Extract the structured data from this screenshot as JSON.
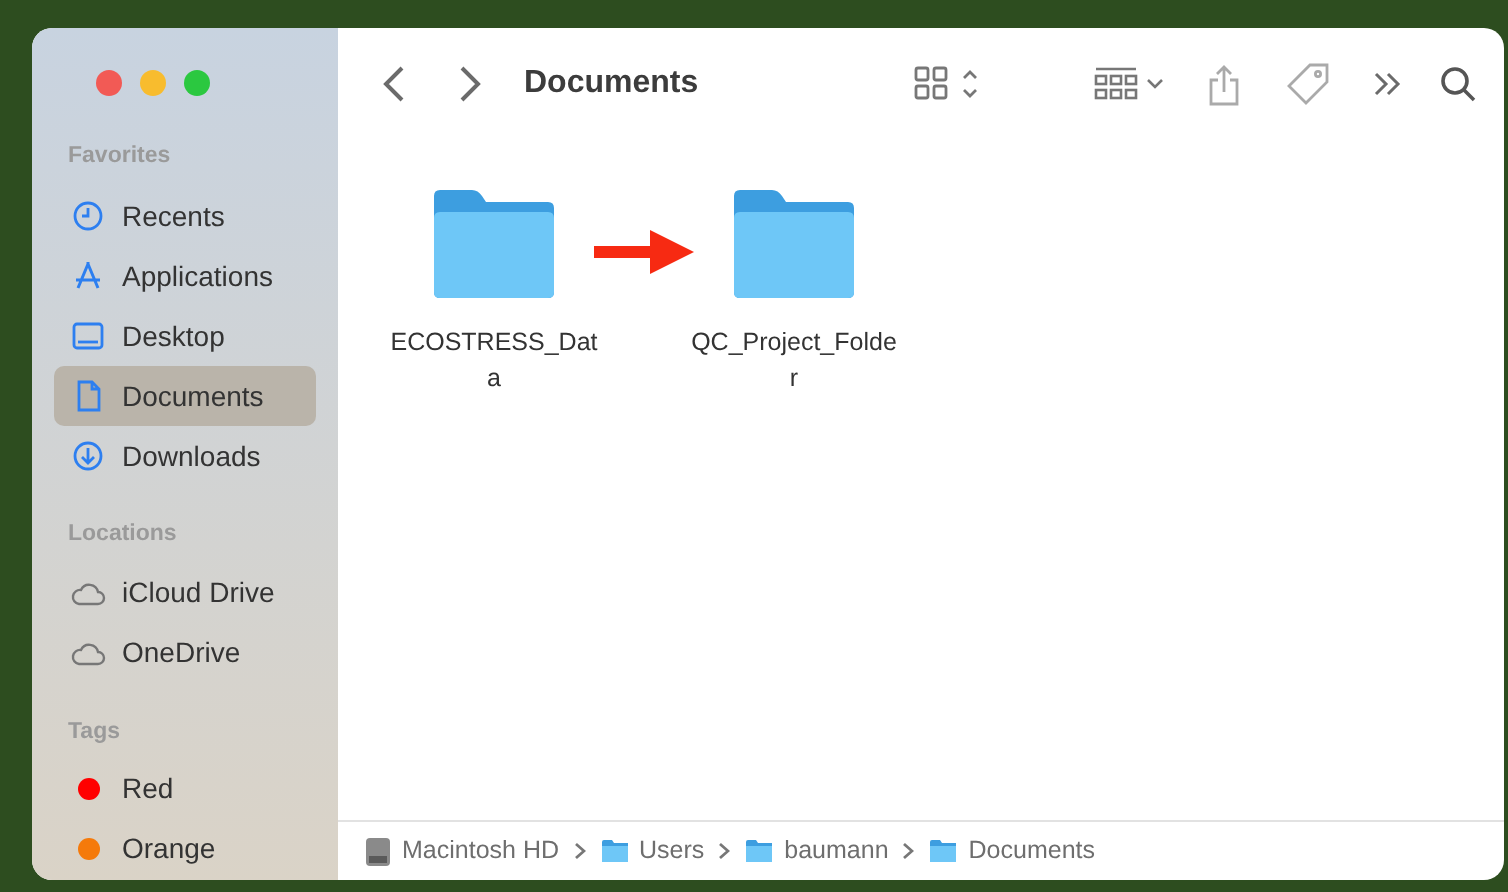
{
  "window": {
    "title": "Documents"
  },
  "sidebar": {
    "sections": [
      {
        "header": "Favorites",
        "items": [
          {
            "label": "Recents",
            "kind": "clock",
            "selected": false
          },
          {
            "label": "Applications",
            "kind": "apps",
            "selected": false
          },
          {
            "label": "Desktop",
            "kind": "desktop",
            "selected": false
          },
          {
            "label": "Documents",
            "kind": "doc",
            "selected": true
          },
          {
            "label": "Downloads",
            "kind": "download",
            "selected": false
          }
        ]
      },
      {
        "header": "Locations",
        "items": [
          {
            "label": "iCloud Drive",
            "kind": "cloud",
            "selected": false
          },
          {
            "label": "OneDrive",
            "kind": "cloud",
            "selected": false
          }
        ]
      },
      {
        "header": "Tags",
        "items": [
          {
            "label": "Red",
            "kind": "tag",
            "color": "#ff0000",
            "selected": false
          },
          {
            "label": "Orange",
            "kind": "tag",
            "color": "#f57a0b",
            "selected": false
          }
        ]
      }
    ]
  },
  "files": [
    {
      "name": "ECOSTRESS_Dat\na"
    },
    {
      "name": "QC_Project_Folde\nr"
    }
  ],
  "path_bar": [
    {
      "label": "Macintosh HD",
      "kind": "disk"
    },
    {
      "label": "Users",
      "kind": "folder"
    },
    {
      "label": "baumann",
      "kind": "folder"
    },
    {
      "label": "Documents",
      "kind": "folder"
    }
  ]
}
